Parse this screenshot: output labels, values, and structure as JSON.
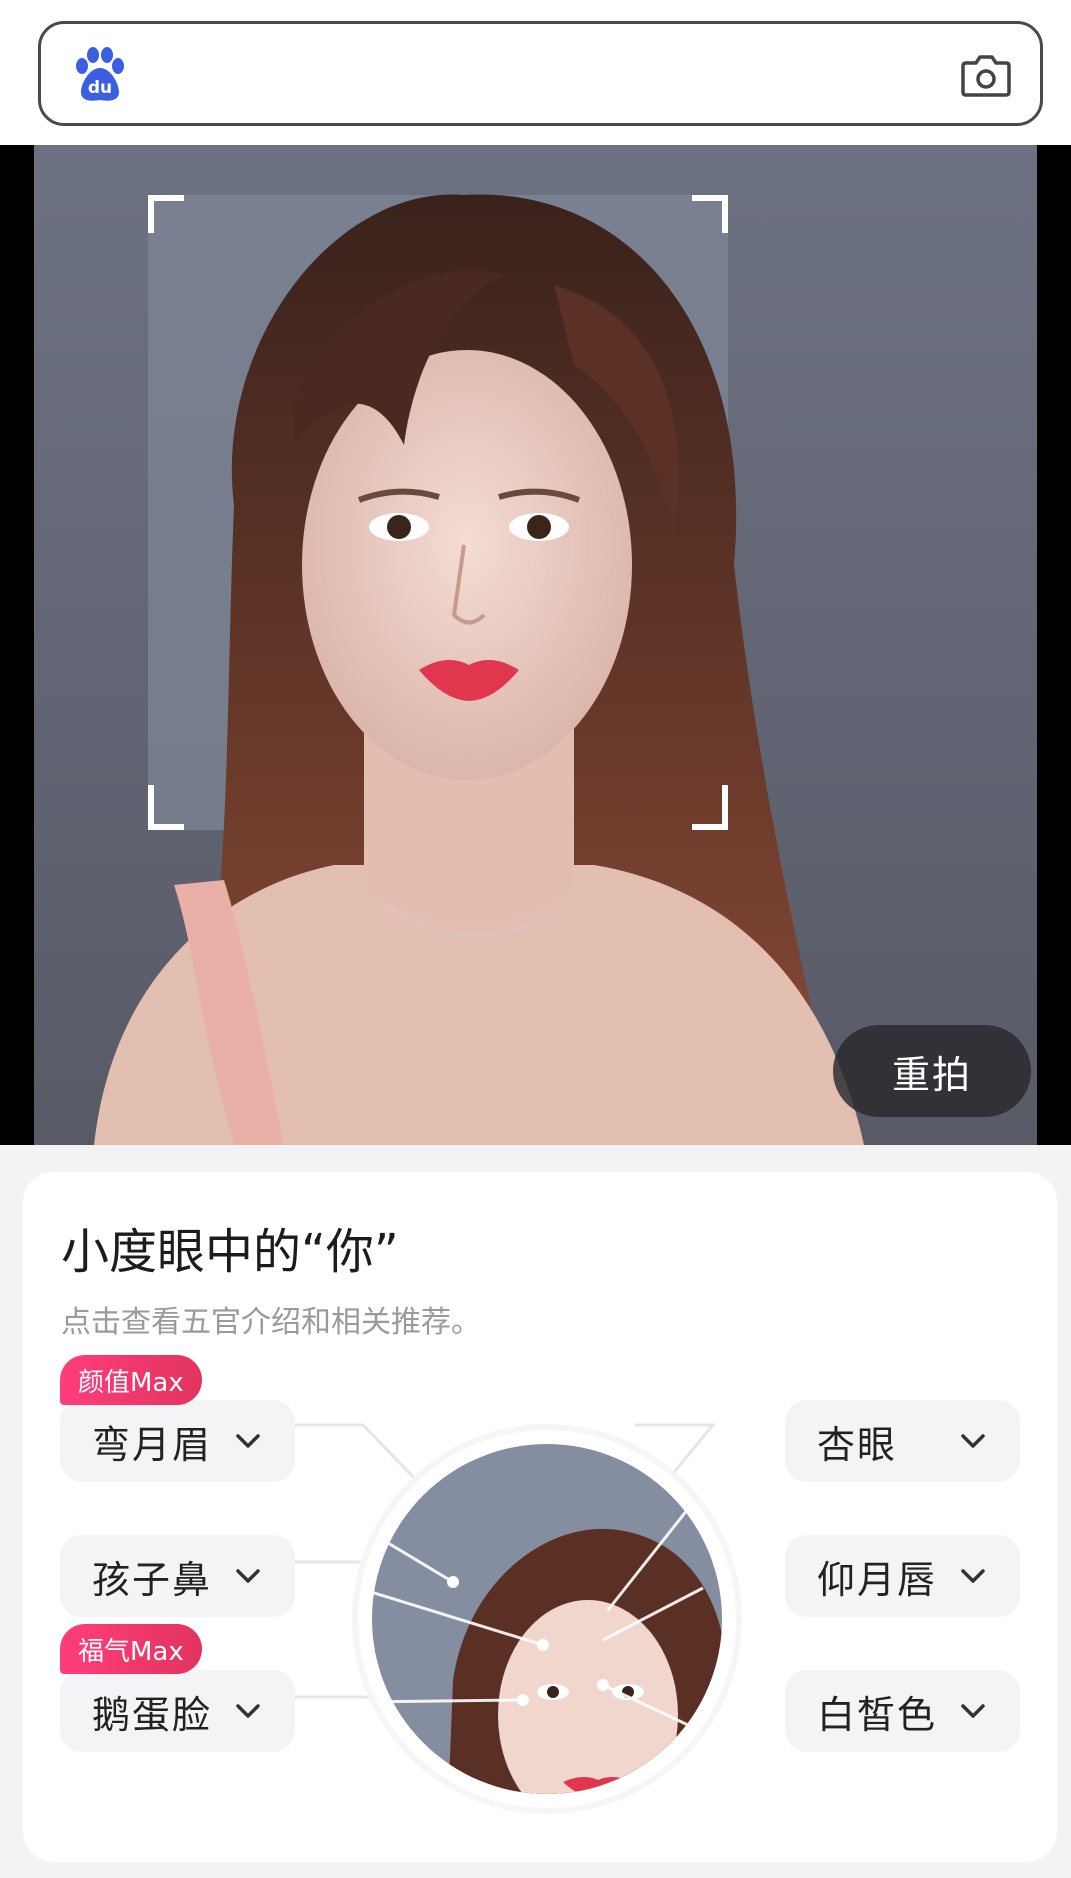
{
  "search": {
    "logo": "baidu-paw-logo",
    "logo_text": "du",
    "camera_icon": "camera-icon"
  },
  "photo": {
    "retake_label": "重拍"
  },
  "result": {
    "title": "小度眼中的“你”",
    "subtitle": "点击查看五官介绍和相关推荐。",
    "left_features": [
      {
        "label": "弯月眉",
        "badge": "颜值Max"
      },
      {
        "label": "孩子鼻",
        "badge": ""
      },
      {
        "label": "鹅蛋脸",
        "badge": "福气Max"
      }
    ],
    "right_features": [
      {
        "label": "杏眼"
      },
      {
        "label": "仰月唇"
      },
      {
        "label": "白皙色"
      }
    ]
  },
  "colors": {
    "badge_pink": "#ff3d7c",
    "chip_bg": "#f4f4f6",
    "page_bg": "#f3f3f4"
  }
}
